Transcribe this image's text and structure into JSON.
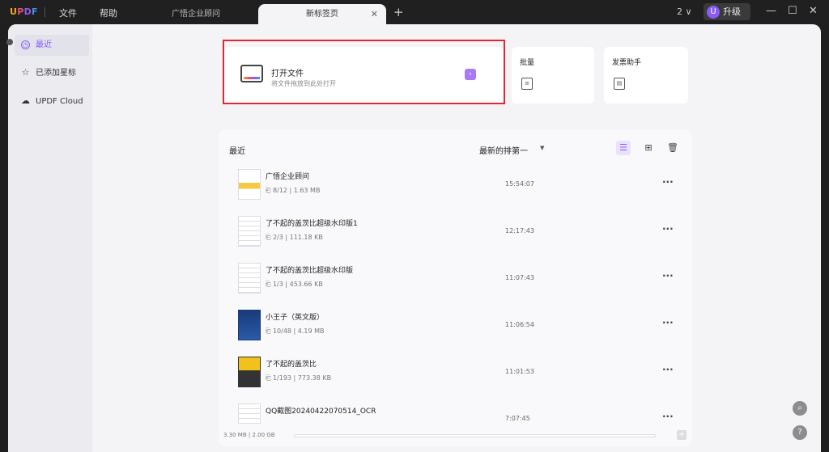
{
  "app": {
    "logo": "UPDF"
  },
  "menu": {
    "file": "文件",
    "help": "帮助"
  },
  "tabs": [
    {
      "label": "广悟企业顾问",
      "active": false
    },
    {
      "label": "新标签页",
      "active": true
    }
  ],
  "titlebar": {
    "page_count": "2 ∨",
    "upgrade_label": "升级",
    "upgrade_badge": "U"
  },
  "sidebar": {
    "items": [
      {
        "label": "最近",
        "active": true,
        "icon": "clock-icon"
      },
      {
        "label": "已添加星标",
        "active": false,
        "icon": "star-icon"
      },
      {
        "label": "UPDF Cloud",
        "active": false,
        "icon": "cloud-icon"
      }
    ]
  },
  "open_card": {
    "title": "打开文件",
    "subtitle": "将文件拖放到此处打开"
  },
  "batch_card": {
    "title": "批量"
  },
  "invoice_card": {
    "title": "发票助手"
  },
  "recent": {
    "title": "最近",
    "sort_label": "最新的排第一",
    "files": [
      {
        "name": "广悟企业顾问",
        "pages": "8/12",
        "size": "1.63 MB",
        "time": "15:54:07",
        "thumb": "yellow"
      },
      {
        "name": "了不起的盖茨比超级水印版1",
        "pages": "2/3",
        "size": "111.18 KB",
        "time": "12:17:43",
        "thumb": "lines"
      },
      {
        "name": "了不起的盖茨比超级水印版",
        "pages": "1/3",
        "size": "453.66 KB",
        "time": "11:07:43",
        "thumb": "lines"
      },
      {
        "name": "小王子（英文版）",
        "pages": "10/48",
        "size": "4.19 MB",
        "time": "11:06:54",
        "thumb": "blue"
      },
      {
        "name": "了不起的盖茨比",
        "pages": "1/193",
        "size": "773.38 KB",
        "time": "11:01:53",
        "thumb": "yb"
      },
      {
        "name": "QQ截图20240422070514_OCR",
        "pages": "",
        "size": "",
        "time": "7:07:45",
        "thumb": "lines"
      }
    ]
  },
  "footer": {
    "storage": "3.30 MB | 2.00 GB"
  },
  "colors": {
    "accent": "#8a5cf5",
    "highlight": "#e0282e"
  }
}
